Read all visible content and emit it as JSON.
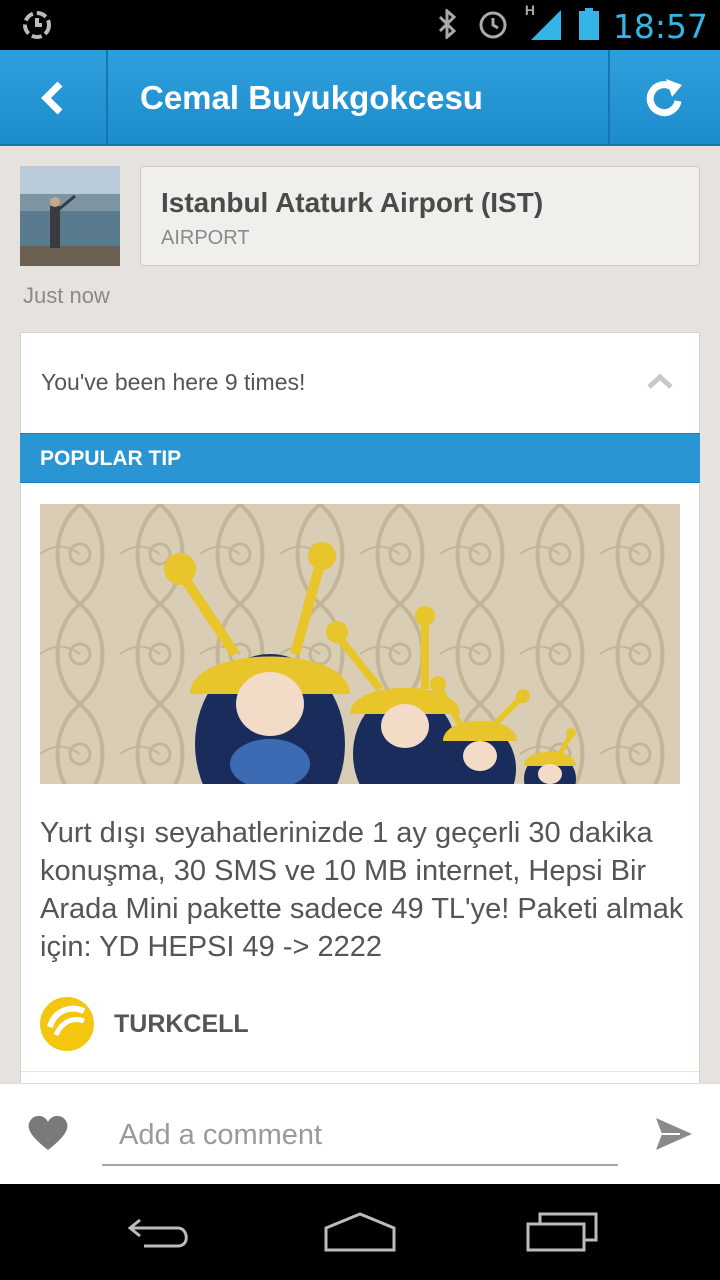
{
  "status_bar": {
    "time": "18:57",
    "icons": [
      "sync-icon",
      "bluetooth-icon",
      "alarm-icon",
      "signal-icon",
      "battery-icon"
    ],
    "network_label": "H"
  },
  "action_bar": {
    "title": "Cemal Buyukgokcesu",
    "back_icon": "chevron-left-icon",
    "refresh_icon": "refresh-icon",
    "color": "#2a95d3"
  },
  "checkin": {
    "venue_name": "Istanbul Ataturk Airport (IST)",
    "venue_category": "AIRPORT",
    "timestamp": "Just now"
  },
  "card": {
    "visits_text": "You've been here 9 times!",
    "tip_header": "POPULAR TIP",
    "tip_text": "Yurt dışı seyahatlerinizde 1 ay geçerli 30 dakika konuşma, 30 SMS ve 10 MB internet, Hepsi Bir Arada Mini pakette sadece 49 TL'ye! Paketi almak için: YD HEPSI 49 -> 2222",
    "tip_author": "TURKCELL",
    "brand_color": "#f4c60f"
  },
  "comment_bar": {
    "placeholder": "Add a comment",
    "like_icon": "heart-icon",
    "send_icon": "send-icon"
  },
  "nav_bar": {
    "buttons": [
      "back-nav-icon",
      "home-nav-icon",
      "recents-nav-icon"
    ]
  }
}
